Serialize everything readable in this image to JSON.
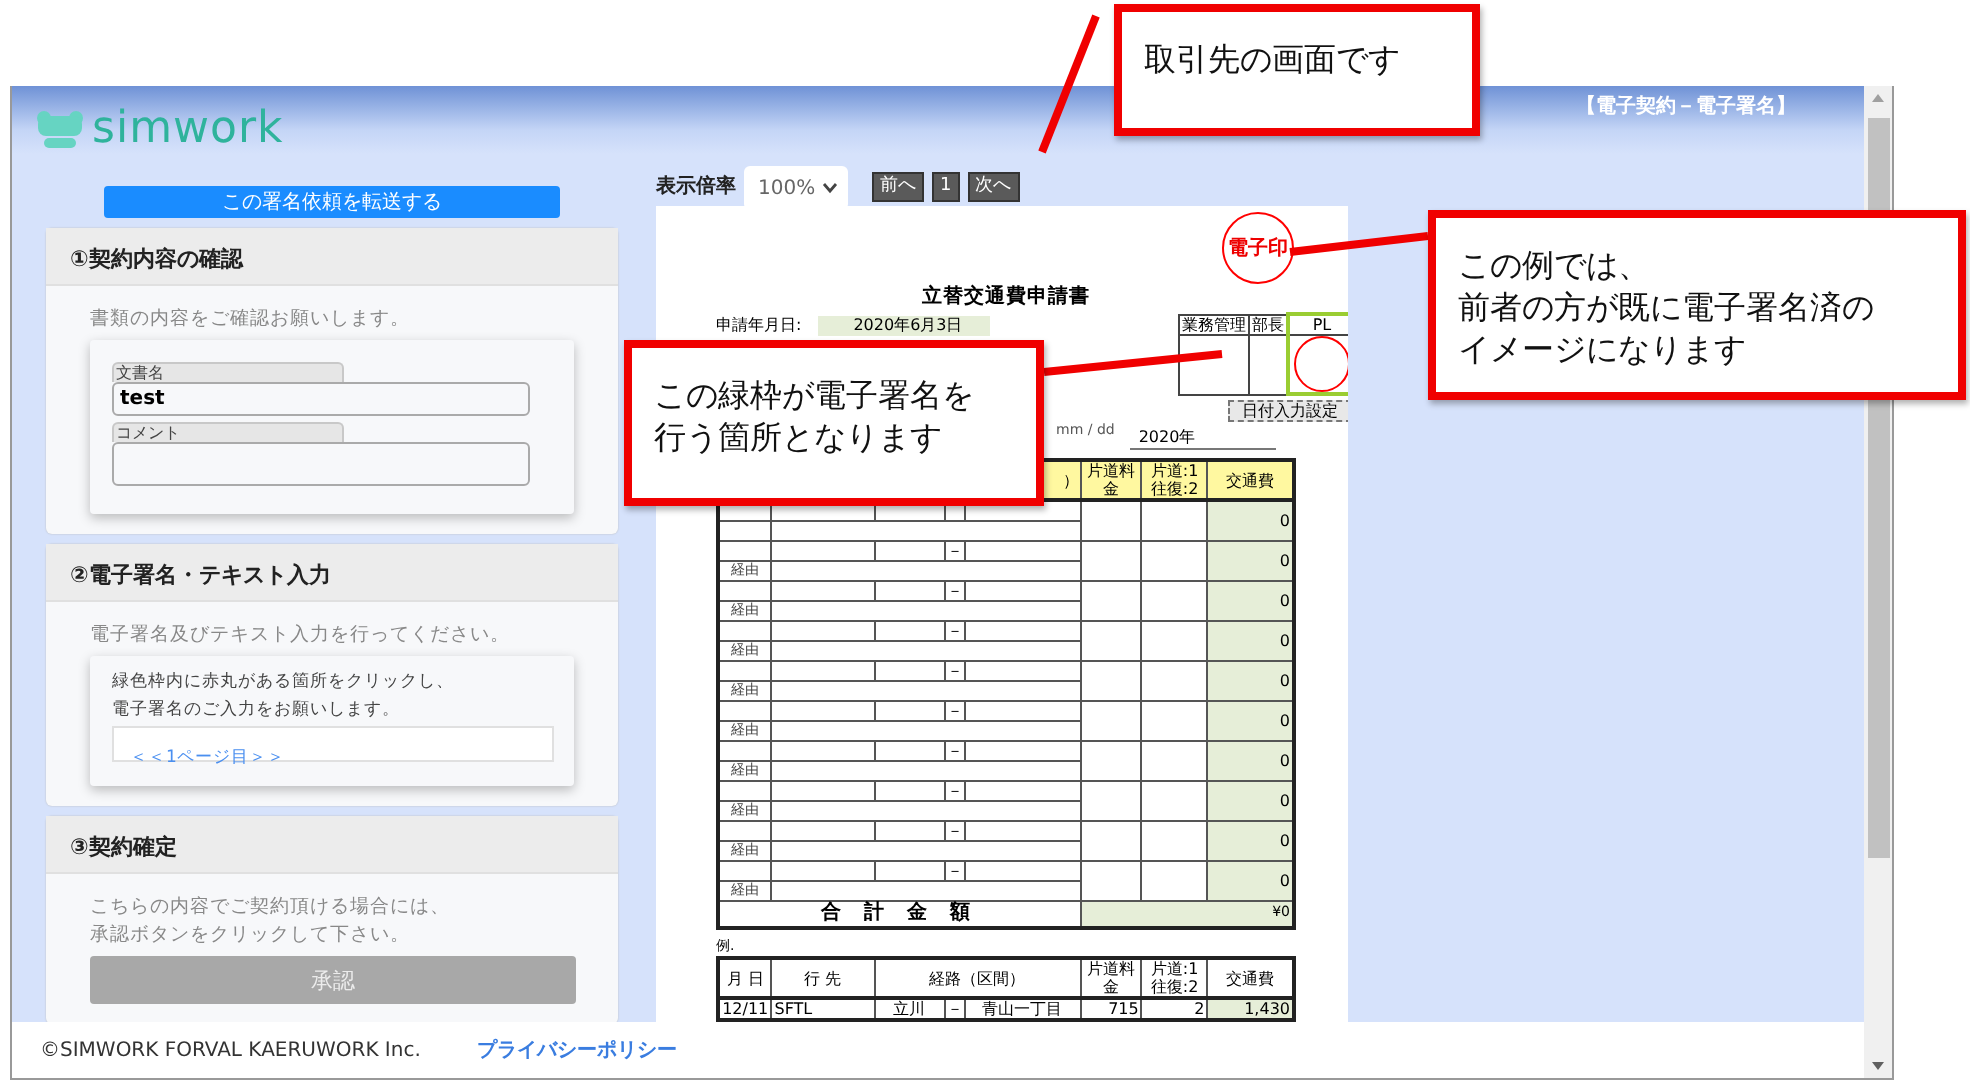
{
  "callouts": [
    {
      "lines": [
        "取引先の画面です"
      ]
    },
    {
      "lines": [
        "この緑枠が電子署名を",
        "行う箇所となります"
      ]
    },
    {
      "lines": [
        "この例では、",
        "前者の方が既に電子署名済の",
        "イメージになります"
      ]
    }
  ],
  "window": {
    "title": "【電子契約－電子署名】"
  },
  "logo": {
    "text": "simwork"
  },
  "forward_button": "この署名依頼を転送する",
  "sections": [
    {
      "kind": "fields",
      "title": "①契約内容の確認",
      "intro": "書類の内容をご確認お願いします。",
      "fields": [
        {
          "label": "文書名",
          "value": "test",
          "multiline": false
        },
        {
          "label": "コメント",
          "multiline": true
        }
      ]
    },
    {
      "kind": "guide",
      "title": "②電子署名・テキスト入力",
      "intro": "電子署名及びテキスト入力を行ってください。",
      "notes": [
        "緑色枠内に赤丸がある箇所をクリックし、",
        "電子署名のご入力をお願いします。"
      ],
      "link": "＜＜1ページ目＞＞"
    },
    {
      "kind": "confirm",
      "title": "③契約確定",
      "notes": [
        "こちらの内容でご契約頂ける場合には、",
        "承認ボタンをクリックして下さい。"
      ],
      "button": {
        "label": "承認",
        "disabled": true
      }
    }
  ],
  "toolbar": {
    "zoom_label": "表示倍率",
    "zoom": "100%",
    "prev": "前へ",
    "page": "1",
    "next": "次へ"
  },
  "document": {
    "stamp": "電子印",
    "title": "立替交通費申請書",
    "date_label": "申請年月日:",
    "date_value": "2020年6月3日",
    "approvals": [
      {
        "label": "業務管理",
        "signature_spot": false
      },
      {
        "label": "部長",
        "signature_spot": false
      },
      {
        "label": "PL",
        "signature_spot": true
      }
    ],
    "date_setting": "日付入力設定",
    "date_format": "mm / dd",
    "year": "2020年",
    "header": {
      "route_fragment": "）",
      "fare": "片道料金",
      "trip": "片道:1 往復:2",
      "cost": "交通費"
    },
    "rows": [
      {
        "cost": "0"
      },
      {
        "via": "経由",
        "dash": "－",
        "cost": "0"
      },
      {
        "via": "経由",
        "dash": "－",
        "cost": "0"
      },
      {
        "via": "経由",
        "dash": "－",
        "cost": "0"
      },
      {
        "via": "経由",
        "dash": "－",
        "cost": "0"
      },
      {
        "via": "経由",
        "dash": "－",
        "cost": "0"
      },
      {
        "via": "経由",
        "dash": "－",
        "cost": "0"
      },
      {
        "via": "経由",
        "dash": "－",
        "cost": "0"
      },
      {
        "via": "経由",
        "dash": "－",
        "cost": "0"
      },
      {
        "via": "経由",
        "dash": "－",
        "cost": "0"
      }
    ],
    "total": {
      "label": "合 計 金 額",
      "value": "¥0"
    },
    "example": {
      "label": "例.",
      "header": [
        "月 日",
        "行 先",
        "経路（区間）",
        "片道料金",
        "片道:1 往復:2",
        "交通費"
      ],
      "row": {
        "date": "12/11",
        "dest": "SFTL",
        "from": "立川",
        "dash": "－",
        "to": "青山一丁目",
        "fare": "715",
        "trip": "2",
        "cost": "1,430"
      }
    }
  },
  "footer": {
    "copyright": "©SIMWORK FORVAL KAERUWORK Inc.",
    "privacy_link": "プライバシーポリシー"
  }
}
